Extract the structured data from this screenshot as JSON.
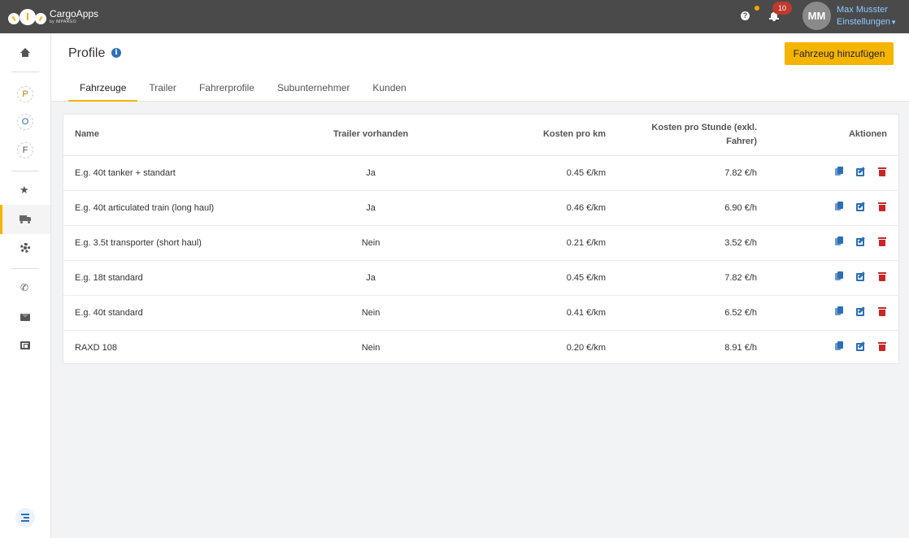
{
  "app": {
    "name": "CargoApps",
    "sub": "by IMPARGO"
  },
  "topbar": {
    "help_icon": "question-circle-icon",
    "notification_count": "10",
    "avatar_initials": "MM",
    "user_name": "Max Musster",
    "settings_label": "Einstellungen"
  },
  "sidebar": {
    "circles": [
      "P",
      "O",
      "F"
    ],
    "icons": [
      "home-icon",
      "star-icon",
      "truck-icon",
      "gear-icon",
      "phone-icon",
      "mail-icon",
      "film-icon",
      "collapse-icon"
    ],
    "active": "truck-icon"
  },
  "page": {
    "title": "Profile",
    "add_button_label": "Fahrzeug hinzufügen"
  },
  "tabs": [
    {
      "label": "Fahrzeuge",
      "active": true
    },
    {
      "label": "Trailer",
      "active": false
    },
    {
      "label": "Fahrerprofile",
      "active": false
    },
    {
      "label": "Subunternehmer",
      "active": false
    },
    {
      "label": "Kunden",
      "active": false
    }
  ],
  "table": {
    "headers": {
      "name": "Name",
      "trailer": "Trailer vorhanden",
      "cost_km": "Kosten pro km",
      "cost_h_line1": "Kosten pro Stunde (exkl.",
      "cost_h_line2": "Fahrer)",
      "actions": "Aktionen"
    },
    "rows": [
      {
        "name": "E.g. 40t tanker + standart",
        "trailer": "Ja",
        "cost_km": "0.45 €/km",
        "cost_h": "7.82 €/h"
      },
      {
        "name": "E.g. 40t articulated train (long haul)",
        "trailer": "Ja",
        "cost_km": "0.46 €/km",
        "cost_h": "6.90 €/h"
      },
      {
        "name": "E.g. 3.5t transporter (short haul)",
        "trailer": "Nein",
        "cost_km": "0.21 €/km",
        "cost_h": "3.52 €/h"
      },
      {
        "name": "E.g. 18t standard",
        "trailer": "Ja",
        "cost_km": "0.45 €/km",
        "cost_h": "7.82 €/h"
      },
      {
        "name": "E.g. 40t standard",
        "trailer": "Nein",
        "cost_km": "0.41 €/km",
        "cost_h": "6.52 €/h"
      },
      {
        "name": "RAXD 108",
        "trailer": "Nein",
        "cost_km": "0.20 €/km",
        "cost_h": "8.91 €/h"
      }
    ]
  },
  "colors": {
    "accent": "#f5b400",
    "topbar": "#4a4a4a",
    "link": "#2d6fb4",
    "danger": "#c62828",
    "badge": "#c0392b"
  }
}
